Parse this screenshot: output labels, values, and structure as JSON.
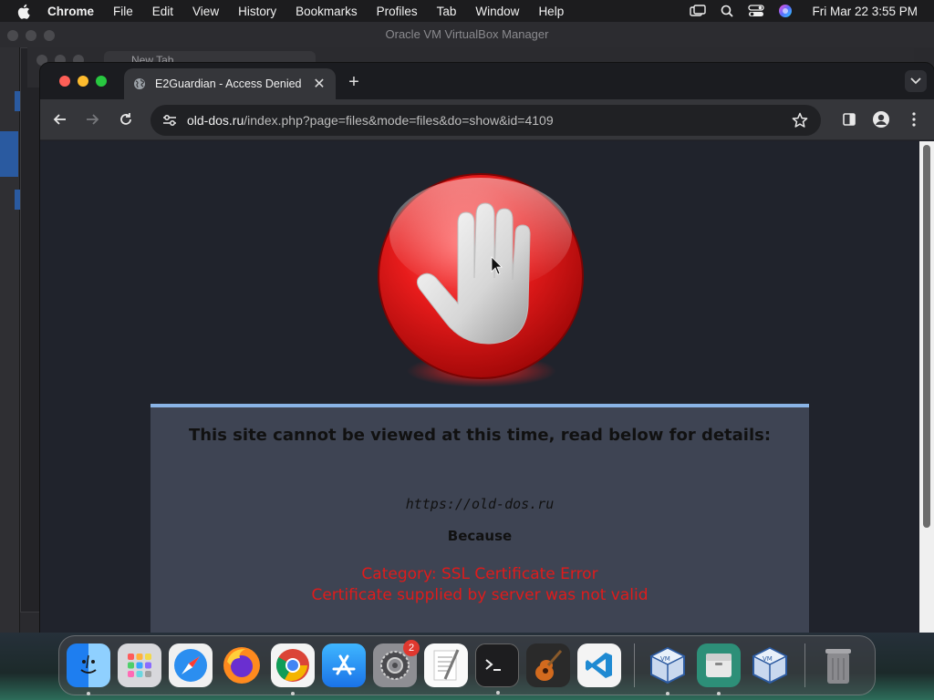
{
  "menubar": {
    "app": "Chrome",
    "items": [
      "File",
      "Edit",
      "View",
      "History",
      "Bookmarks",
      "Profiles",
      "Tab",
      "Window",
      "Help"
    ],
    "clock": "Fri Mar 22  3:55 PM"
  },
  "background_window": {
    "title": "Oracle VM VirtualBox Manager",
    "ghost_tab": "New Tab"
  },
  "browser": {
    "tab_title": "E2Guardian - Access Denied",
    "url_host": "old-dos.ru",
    "url_path": "/index.php?page=files&mode=files&do=show&id=4109"
  },
  "page": {
    "heading": "This site cannot be viewed at this time, read below for details:",
    "site": "https://old-dos.ru",
    "because": "Because",
    "reason_line1": "Category: SSL Certificate Error",
    "reason_line2": "Certificate supplied by server was not valid"
  },
  "dock": {
    "items": [
      "finder",
      "launchpad",
      "safari",
      "firefox",
      "chrome",
      "app-store",
      "system-settings",
      "textedit",
      "terminal",
      "garageband",
      "vscode",
      "virtualbox",
      "archive-utility",
      "virtualbox-2",
      "trash"
    ],
    "settings_badge": "2"
  },
  "colors": {
    "panel_bg": "#3e4453",
    "reason_red": "#e01b1b",
    "page_bg": "#20232c",
    "panel_border": "#8ab4e6"
  }
}
